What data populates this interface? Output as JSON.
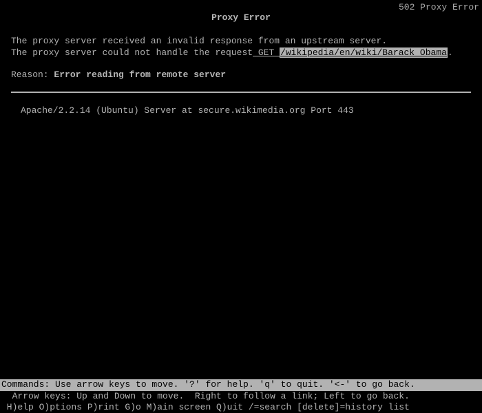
{
  "titlebar": {
    "status": "502 Proxy Error"
  },
  "page": {
    "heading": "Proxy Error",
    "line1": "The proxy server received an invalid response from an upstream server.",
    "line2_prefix": "The proxy server could not handle the request",
    "request_method_link": " GET ",
    "request_path_link": "/wikipedia/en/wiki/Barack_Obama",
    "line2_suffix": ".",
    "reason_label": "Reason: ",
    "reason_text": "Error reading from remote server",
    "server_signature": "Apache/2.2.14 (Ubuntu) Server at secure.wikimedia.org Port 443"
  },
  "status": {
    "line1": "Commands: Use arrow keys to move. '?' for help. 'q' to quit. '<-' to go back.",
    "line2": "  Arrow keys: Up and Down to move.  Right to follow a link; Left to go back.",
    "line3": " H)elp O)ptions P)rint G)o M)ain screen Q)uit /=search [delete]=history list"
  }
}
